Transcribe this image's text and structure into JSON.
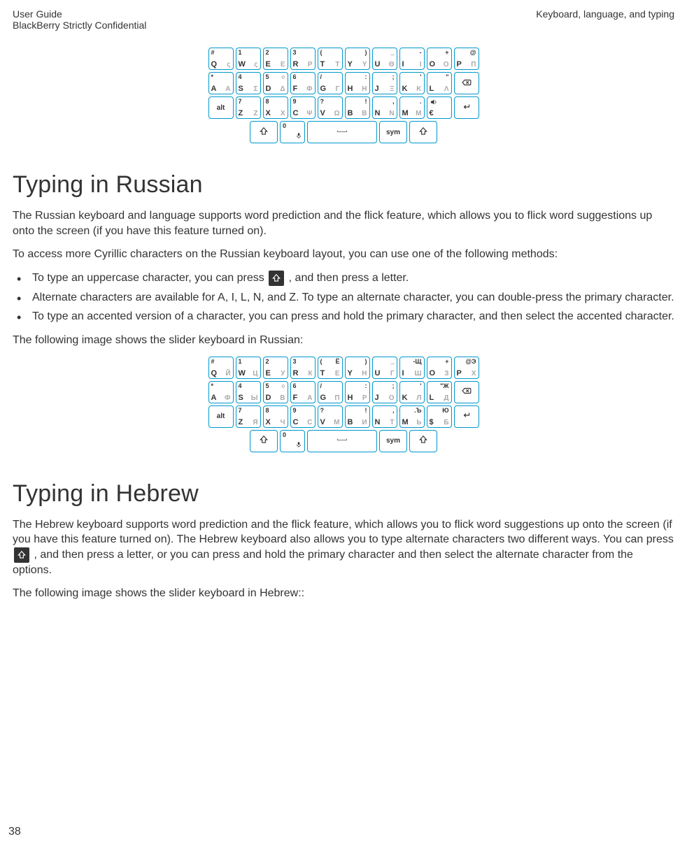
{
  "header": {
    "left1": "User Guide",
    "left2": "BlackBerry Strictly Confidential",
    "right": "Keyboard, language, and typing"
  },
  "section1": {
    "title": "Typing in Russian",
    "para1": "The Russian keyboard and language supports word prediction and the flick feature, which allows you to flick word suggestions up onto the screen (if you have this feature turned on).",
    "para2": "To access more Cyrillic characters on the Russian keyboard layout, you can use one of the following methods:",
    "bullet1a": "To type an uppercase character, you can press ",
    "bullet1b": " , and then press a letter.",
    "bullet2": "Alternate characters are available for A, I, L, N, and Z. To type an alternate character, you can double-press the primary character.",
    "bullet3": "To type an accented version of a character, you can press and hold the primary character, and then select the accented character.",
    "para3": "The following image shows the slider keyboard in Russian:"
  },
  "section2": {
    "title": "Typing in Hebrew",
    "para1a": "The Hebrew keyboard supports word prediction and the flick feature, which allows you to flick word suggestions up onto the screen (if you have this feature turned on). The Hebrew keyboard also allows you to type alternate characters two different ways. You can press ",
    "para1b": " , and then press a letter, or you can press and hold the primary character and then select the alternate character from the options.",
    "para2": "The following image shows the slider keyboard in Hebrew::"
  },
  "pageNumber": "38",
  "kb_greek": {
    "rows": [
      [
        {
          "tl": "#",
          "bl": "Q",
          "br": "ς",
          "tr": ""
        },
        {
          "tl": "1",
          "bl": "W",
          "br": "ς",
          "tr": ""
        },
        {
          "tl": "2",
          "bl": "E",
          "br": "Ε",
          "tr": ""
        },
        {
          "tl": "3",
          "bl": "R",
          "br": "Ρ",
          "tr": ""
        },
        {
          "tl": "(",
          "bl": "T",
          "br": "Τ",
          "tr": ""
        },
        {
          "tl": "",
          "bl": "Y",
          "br": "Υ",
          "tr": ")"
        },
        {
          "tl": "",
          "bl": "U",
          "br": "Θ",
          "tr": "_"
        },
        {
          "tl": "",
          "bl": "I",
          "br": "Ι",
          "tr": "-"
        },
        {
          "tl": "",
          "bl": "O",
          "br": "Ο",
          "tr": "+"
        },
        {
          "tl": "",
          "bl": "P",
          "br": "Π",
          "tr": "@"
        }
      ],
      [
        {
          "tl": "*",
          "bl": "A",
          "br": "Α",
          "tr": ""
        },
        {
          "tl": "4",
          "bl": "S",
          "br": "Σ",
          "tr": ""
        },
        {
          "tl": "5",
          "bl": "D",
          "br": "Δ",
          "tr": "○"
        },
        {
          "tl": "6",
          "bl": "F",
          "br": "Φ",
          "tr": ""
        },
        {
          "tl": "/",
          "bl": "G",
          "br": "Γ",
          "tr": ""
        },
        {
          "tl": "",
          "bl": "H",
          "br": "Η",
          "tr": ":"
        },
        {
          "tl": "",
          "bl": "J",
          "br": "Ξ",
          "tr": ";"
        },
        {
          "tl": "",
          "bl": "K",
          "br": "Κ",
          "tr": "'"
        },
        {
          "tl": "",
          "bl": "L",
          "br": "Λ",
          "tr": "\""
        },
        {
          "icon": "backspace"
        }
      ],
      [
        {
          "center": "alt"
        },
        {
          "tl": "7",
          "bl": "Z",
          "br": "Ζ",
          "tr": ""
        },
        {
          "tl": "8",
          "bl": "X",
          "br": "Χ",
          "tr": ""
        },
        {
          "tl": "9",
          "bl": "C",
          "br": "Ψ",
          "tr": ""
        },
        {
          "tl": "?",
          "bl": "V",
          "br": "Ω",
          "tr": ""
        },
        {
          "tl": "",
          "bl": "B",
          "br": "Β",
          "tr": "!"
        },
        {
          "tl": "",
          "bl": "N",
          "br": "Ν",
          "tr": ","
        },
        {
          "tl": "",
          "bl": "M",
          "br": "Μ",
          "tr": "."
        },
        {
          "tl": "",
          "bl": "€",
          "br": "",
          "tr": "",
          "icon": "speaker"
        },
        {
          "icon": "enter"
        }
      ]
    ],
    "bottom": {
      "shift_left": true,
      "zero": {
        "tl": "0",
        "mic": true
      },
      "space": true,
      "sym": "sym",
      "shift_right": true
    }
  },
  "kb_russian": {
    "rows": [
      [
        {
          "tl": "#",
          "bl": "Q",
          "br": "Й",
          "tr": ""
        },
        {
          "tl": "1",
          "bl": "W",
          "br": "Ц",
          "tr": ""
        },
        {
          "tl": "2",
          "bl": "E",
          "br": "У",
          "tr": ""
        },
        {
          "tl": "3",
          "bl": "R",
          "br": "К",
          "tr": ""
        },
        {
          "tl": "(",
          "bl": "T",
          "br": "Е",
          "tr": "Ё"
        },
        {
          "tl": "",
          "bl": "Y",
          "br": "Н",
          "tr": ")"
        },
        {
          "tl": "",
          "bl": "U",
          "br": "Г",
          "tr": "_"
        },
        {
          "tl": "",
          "bl": "I",
          "br": "Ш",
          "tr": "-Щ"
        },
        {
          "tl": "",
          "bl": "O",
          "br": "З",
          "tr": "+"
        },
        {
          "tl": "",
          "bl": "P",
          "br": "Х",
          "tr": "@Э"
        }
      ],
      [
        {
          "tl": "*",
          "bl": "A",
          "br": "Ф",
          "tr": ""
        },
        {
          "tl": "4",
          "bl": "S",
          "br": "Ы",
          "tr": ""
        },
        {
          "tl": "5",
          "bl": "D",
          "br": "В",
          "tr": "○"
        },
        {
          "tl": "6",
          "bl": "F",
          "br": "А",
          "tr": ""
        },
        {
          "tl": "/",
          "bl": "G",
          "br": "П",
          "tr": ""
        },
        {
          "tl": "",
          "bl": "H",
          "br": "Р",
          "tr": ":"
        },
        {
          "tl": "",
          "bl": "J",
          "br": "О",
          "tr": ";"
        },
        {
          "tl": "",
          "bl": "K",
          "br": "Л",
          "tr": "'"
        },
        {
          "tl": "",
          "bl": "L",
          "br": "Д",
          "tr": "\"Ж"
        },
        {
          "icon": "backspace"
        }
      ],
      [
        {
          "center": "alt"
        },
        {
          "tl": "7",
          "bl": "Z",
          "br": "Я",
          "tr": ""
        },
        {
          "tl": "8",
          "bl": "X",
          "br": "Ч",
          "tr": ""
        },
        {
          "tl": "9",
          "bl": "C",
          "br": "С",
          "tr": ""
        },
        {
          "tl": "?",
          "bl": "V",
          "br": "М",
          "tr": ""
        },
        {
          "tl": "",
          "bl": "B",
          "br": "И",
          "tr": "!"
        },
        {
          "tl": "",
          "bl": "N",
          "br": "Т",
          "tr": ","
        },
        {
          "tl": "",
          "bl": "M",
          "br": "Ь",
          "tr": ".Ъ"
        },
        {
          "tl": "",
          "bl": "$",
          "br": "Б",
          "tr": "Ю"
        },
        {
          "icon": "enter"
        }
      ]
    ],
    "bottom": {
      "shift_left": true,
      "zero": {
        "tl": "0",
        "mic": true
      },
      "space": true,
      "sym": "sym",
      "shift_right": true
    }
  }
}
